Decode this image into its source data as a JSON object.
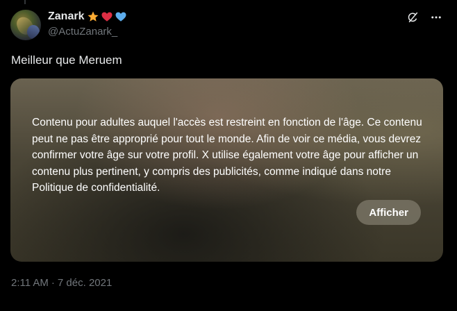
{
  "author": {
    "display_name": "Zanark",
    "handle": "@ActuZanark_",
    "badges": [
      "star-emoji",
      "red-heart-emoji",
      "blue-heart-emoji"
    ]
  },
  "tweet": {
    "text": "Meilleur que Meruem",
    "media_warning": "Contenu pour adultes auquel l'accès est restreint en fonction de l'âge. Ce contenu peut ne pas être approprié pour tout le monde. Afin de voir ce média, vous devrez confirmer votre âge sur votre profil. X utilise également votre âge pour afficher un contenu plus pertinent, y compris des publicités, comme indiqué dans notre Politique de confidentialité.",
    "show_button_label": "Afficher",
    "time": "2:11 AM",
    "separator": "·",
    "date": "7 déc. 2021"
  },
  "icons": {
    "header_actions": [
      "grok-icon",
      "more-icon"
    ]
  },
  "colors": {
    "background": "#000000",
    "text": "#e7e9ea",
    "muted": "#71767b",
    "button_bg": "#78736480"
  }
}
